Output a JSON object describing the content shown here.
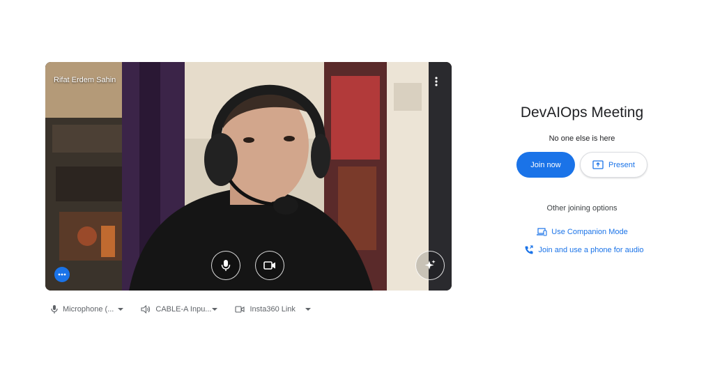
{
  "preview": {
    "participant_name": "Rifat Erdem Sahin"
  },
  "devices": {
    "microphone": "Microphone (...",
    "speaker": "CABLE-A Inpu...",
    "camera": "Insta360 Link"
  },
  "meeting": {
    "title": "DevAIOps Meeting",
    "status": "No one else is here",
    "join_label": "Join now",
    "present_label": "Present",
    "other_options_label": "Other joining options",
    "companion_mode_label": "Use Companion Mode",
    "phone_audio_label": "Join and use a phone for audio"
  },
  "colors": {
    "accent": "#1a73e8",
    "text_primary": "#202124",
    "text_secondary": "#5f6368"
  }
}
